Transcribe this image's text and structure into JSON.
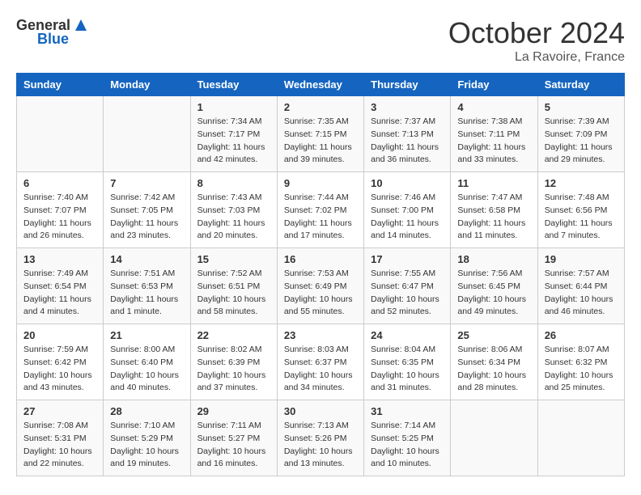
{
  "header": {
    "logo_general": "General",
    "logo_blue": "Blue",
    "month": "October 2024",
    "location": "La Ravoire, France"
  },
  "days_of_week": [
    "Sunday",
    "Monday",
    "Tuesday",
    "Wednesday",
    "Thursday",
    "Friday",
    "Saturday"
  ],
  "weeks": [
    [
      {
        "day": "",
        "info": ""
      },
      {
        "day": "",
        "info": ""
      },
      {
        "day": "1",
        "info": "Sunrise: 7:34 AM\nSunset: 7:17 PM\nDaylight: 11 hours and 42 minutes."
      },
      {
        "day": "2",
        "info": "Sunrise: 7:35 AM\nSunset: 7:15 PM\nDaylight: 11 hours and 39 minutes."
      },
      {
        "day": "3",
        "info": "Sunrise: 7:37 AM\nSunset: 7:13 PM\nDaylight: 11 hours and 36 minutes."
      },
      {
        "day": "4",
        "info": "Sunrise: 7:38 AM\nSunset: 7:11 PM\nDaylight: 11 hours and 33 minutes."
      },
      {
        "day": "5",
        "info": "Sunrise: 7:39 AM\nSunset: 7:09 PM\nDaylight: 11 hours and 29 minutes."
      }
    ],
    [
      {
        "day": "6",
        "info": "Sunrise: 7:40 AM\nSunset: 7:07 PM\nDaylight: 11 hours and 26 minutes."
      },
      {
        "day": "7",
        "info": "Sunrise: 7:42 AM\nSunset: 7:05 PM\nDaylight: 11 hours and 23 minutes."
      },
      {
        "day": "8",
        "info": "Sunrise: 7:43 AM\nSunset: 7:03 PM\nDaylight: 11 hours and 20 minutes."
      },
      {
        "day": "9",
        "info": "Sunrise: 7:44 AM\nSunset: 7:02 PM\nDaylight: 11 hours and 17 minutes."
      },
      {
        "day": "10",
        "info": "Sunrise: 7:46 AM\nSunset: 7:00 PM\nDaylight: 11 hours and 14 minutes."
      },
      {
        "day": "11",
        "info": "Sunrise: 7:47 AM\nSunset: 6:58 PM\nDaylight: 11 hours and 11 minutes."
      },
      {
        "day": "12",
        "info": "Sunrise: 7:48 AM\nSunset: 6:56 PM\nDaylight: 11 hours and 7 minutes."
      }
    ],
    [
      {
        "day": "13",
        "info": "Sunrise: 7:49 AM\nSunset: 6:54 PM\nDaylight: 11 hours and 4 minutes."
      },
      {
        "day": "14",
        "info": "Sunrise: 7:51 AM\nSunset: 6:53 PM\nDaylight: 11 hours and 1 minute."
      },
      {
        "day": "15",
        "info": "Sunrise: 7:52 AM\nSunset: 6:51 PM\nDaylight: 10 hours and 58 minutes."
      },
      {
        "day": "16",
        "info": "Sunrise: 7:53 AM\nSunset: 6:49 PM\nDaylight: 10 hours and 55 minutes."
      },
      {
        "day": "17",
        "info": "Sunrise: 7:55 AM\nSunset: 6:47 PM\nDaylight: 10 hours and 52 minutes."
      },
      {
        "day": "18",
        "info": "Sunrise: 7:56 AM\nSunset: 6:45 PM\nDaylight: 10 hours and 49 minutes."
      },
      {
        "day": "19",
        "info": "Sunrise: 7:57 AM\nSunset: 6:44 PM\nDaylight: 10 hours and 46 minutes."
      }
    ],
    [
      {
        "day": "20",
        "info": "Sunrise: 7:59 AM\nSunset: 6:42 PM\nDaylight: 10 hours and 43 minutes."
      },
      {
        "day": "21",
        "info": "Sunrise: 8:00 AM\nSunset: 6:40 PM\nDaylight: 10 hours and 40 minutes."
      },
      {
        "day": "22",
        "info": "Sunrise: 8:02 AM\nSunset: 6:39 PM\nDaylight: 10 hours and 37 minutes."
      },
      {
        "day": "23",
        "info": "Sunrise: 8:03 AM\nSunset: 6:37 PM\nDaylight: 10 hours and 34 minutes."
      },
      {
        "day": "24",
        "info": "Sunrise: 8:04 AM\nSunset: 6:35 PM\nDaylight: 10 hours and 31 minutes."
      },
      {
        "day": "25",
        "info": "Sunrise: 8:06 AM\nSunset: 6:34 PM\nDaylight: 10 hours and 28 minutes."
      },
      {
        "day": "26",
        "info": "Sunrise: 8:07 AM\nSunset: 6:32 PM\nDaylight: 10 hours and 25 minutes."
      }
    ],
    [
      {
        "day": "27",
        "info": "Sunrise: 7:08 AM\nSunset: 5:31 PM\nDaylight: 10 hours and 22 minutes."
      },
      {
        "day": "28",
        "info": "Sunrise: 7:10 AM\nSunset: 5:29 PM\nDaylight: 10 hours and 19 minutes."
      },
      {
        "day": "29",
        "info": "Sunrise: 7:11 AM\nSunset: 5:27 PM\nDaylight: 10 hours and 16 minutes."
      },
      {
        "day": "30",
        "info": "Sunrise: 7:13 AM\nSunset: 5:26 PM\nDaylight: 10 hours and 13 minutes."
      },
      {
        "day": "31",
        "info": "Sunrise: 7:14 AM\nSunset: 5:25 PM\nDaylight: 10 hours and 10 minutes."
      },
      {
        "day": "",
        "info": ""
      },
      {
        "day": "",
        "info": ""
      }
    ]
  ]
}
